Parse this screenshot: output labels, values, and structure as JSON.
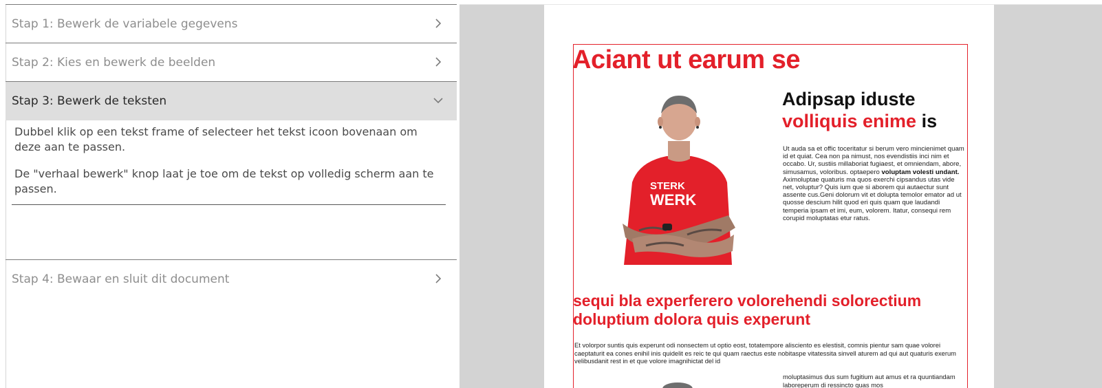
{
  "steps": [
    {
      "label": "Stap 1: Bewerk de variabele gegevens",
      "state": "collapsed"
    },
    {
      "label": "Stap 2: Kies en bewerk de beelden",
      "state": "collapsed"
    },
    {
      "label": "Stap 3: Bewerk de teksten",
      "state": "expanded"
    },
    {
      "label": "Stap 4: Bewaar en sluit dit document",
      "state": "collapsed"
    }
  ],
  "help": {
    "p1": "Dubbel klik op een tekst frame of selecteer het tekst icoon bovenaan om deze aan te passen.",
    "p2": "De \"verhaal bewerk\" knop laat je toe om de tekst op volledig scherm aan te passen."
  },
  "document": {
    "headline": "Aciant ut earum se",
    "subhead_line1": "Adipsap iduste",
    "subhead_red": "volliquis enime",
    "subhead_tail": " is",
    "body1_a": "Ut auda sa et offic toceritatur si berum vero mincienimet quam id et quiat. Cea non pa nimust, nos evendistiis inci nim et occabo. Ur, sustiis millaboriat fugiaest, et omniendam, abore, simusamus, voloribus. optaepero ",
    "body1_bold": "voluptam volesti undant.",
    "body1_b": " Aximoluptae quaturis ma quos exerchi cipsandus utas vide net, voluptur? Quis ium que si aborem qui autaectur sunt assente cus.Geni dolorum vit et dolupta temolor emator ad ut quosse descium hilit quod eri quis quam que laudandi temperia ipsam et imi, eum, volorem. Itatur, consequi rem corupid moluptatas etur ratus.",
    "section": "sequi bla experferero volorehendi solorectium doluptium dolora quis experunt",
    "body2": "Et volorpor suntis quis experunt odi nonsectem ut optio eost, totatempore alisciento es elestisit, comnis pientur sam quae volorei caeptaturit ea cones enihil inis quidelit es reic te qui quam raectus este nobitaspe vitatessita sinvell aturem ad qui aut quaturis exerum velibusdanit rest in et que volore imagnihictat del id",
    "body3": "moluptasimus dus sum fugitium aut amus et ra quuntiandam laboreperum di ressincto quas mos",
    "accent_color": "#e3202a",
    "shirt_logo": "STERK WERK"
  }
}
